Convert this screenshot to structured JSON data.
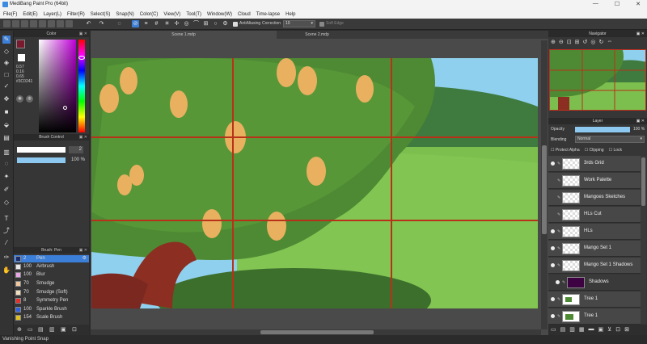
{
  "app": {
    "title": "MediBang Paint Pro (64bit)"
  },
  "window_controls": {
    "minimize": "—",
    "maximize": "☐",
    "close": "✕"
  },
  "menu": [
    "File(F)",
    "Edit(E)",
    "Layer(L)",
    "Filter(R)",
    "Select(S)",
    "Snap(N)",
    "Color(C)",
    "View(V)",
    "Tool(T)",
    "Window(W)",
    "Cloud",
    "Time-lapse",
    "Help"
  ],
  "toolbar": {
    "antialiasing_label": "AntiAliasing",
    "correction_label": "Correction",
    "correction_value": "10",
    "soft_edge_label": "Soft Edge",
    "undo_icon": "undo-icon",
    "redo_icon": "redo-icon"
  },
  "color_panel": {
    "title": "Color",
    "values": [
      "0.57",
      "0.16",
      "0.65",
      "#3C0241"
    ],
    "fg_color": "#7a1a2e",
    "bg_color": "#ffffff"
  },
  "brush_control": {
    "title": "Brush Control",
    "size": "2",
    "opacity": "100 %"
  },
  "brush_panel": {
    "title": "Brush: Pen",
    "items": [
      {
        "size": "2",
        "name": "Pen",
        "color": "#1a2a6a",
        "selected": true
      },
      {
        "size": "100",
        "name": "Airbrush",
        "color": "#e8e8e8",
        "selected": false
      },
      {
        "size": "100",
        "name": "Blur",
        "color": "#e8a8e8",
        "selected": false
      },
      {
        "size": "70",
        "name": "Smudge",
        "color": "#f0c8a0",
        "selected": false
      },
      {
        "size": "70",
        "name": "Smudge (Soft)",
        "color": "#f0e0c0",
        "selected": false
      },
      {
        "size": "8",
        "name": "Symmetry Pen",
        "color": "#e03030",
        "selected": false
      },
      {
        "size": "100",
        "name": "Sparkle Brush",
        "color": "#3060e0",
        "selected": false
      },
      {
        "size": "154",
        "name": "Scale Brush",
        "color": "#e0c020",
        "selected": false
      }
    ]
  },
  "tabs": [
    {
      "label": "Scene 1.mdp",
      "active": true
    },
    {
      "label": "Scene 2.mdp",
      "active": false
    }
  ],
  "navigator": {
    "title": "Navigator"
  },
  "layer_panel": {
    "title": "Layer",
    "opacity_label": "Opacity",
    "opacity_value": "100 %",
    "blending_label": "Blending",
    "blending_value": "Normal",
    "protect_alpha": "Protect Alpha",
    "clipping": "Clipping",
    "lock": "Lock",
    "layers": [
      {
        "name": "3rds Grid",
        "visible": true,
        "selected": false
      },
      {
        "name": "Work Palette",
        "visible": false,
        "selected": false
      },
      {
        "name": "Mangoes Sketches",
        "visible": false,
        "selected": false
      },
      {
        "name": "HLs Cut",
        "visible": false,
        "selected": false
      },
      {
        "name": "HLs",
        "visible": true,
        "selected": false
      },
      {
        "name": "Mango Set 1",
        "visible": true,
        "selected": false
      },
      {
        "name": "Mango Set 1 Shadows",
        "visible": true,
        "selected": false
      },
      {
        "name": "Shadows",
        "visible": true,
        "selected": true
      },
      {
        "name": "Tree 1",
        "visible": true,
        "selected": false
      },
      {
        "name": "Tree 1",
        "visible": true,
        "selected": false
      }
    ]
  },
  "status": {
    "text": "Vanishing Point Snap"
  }
}
